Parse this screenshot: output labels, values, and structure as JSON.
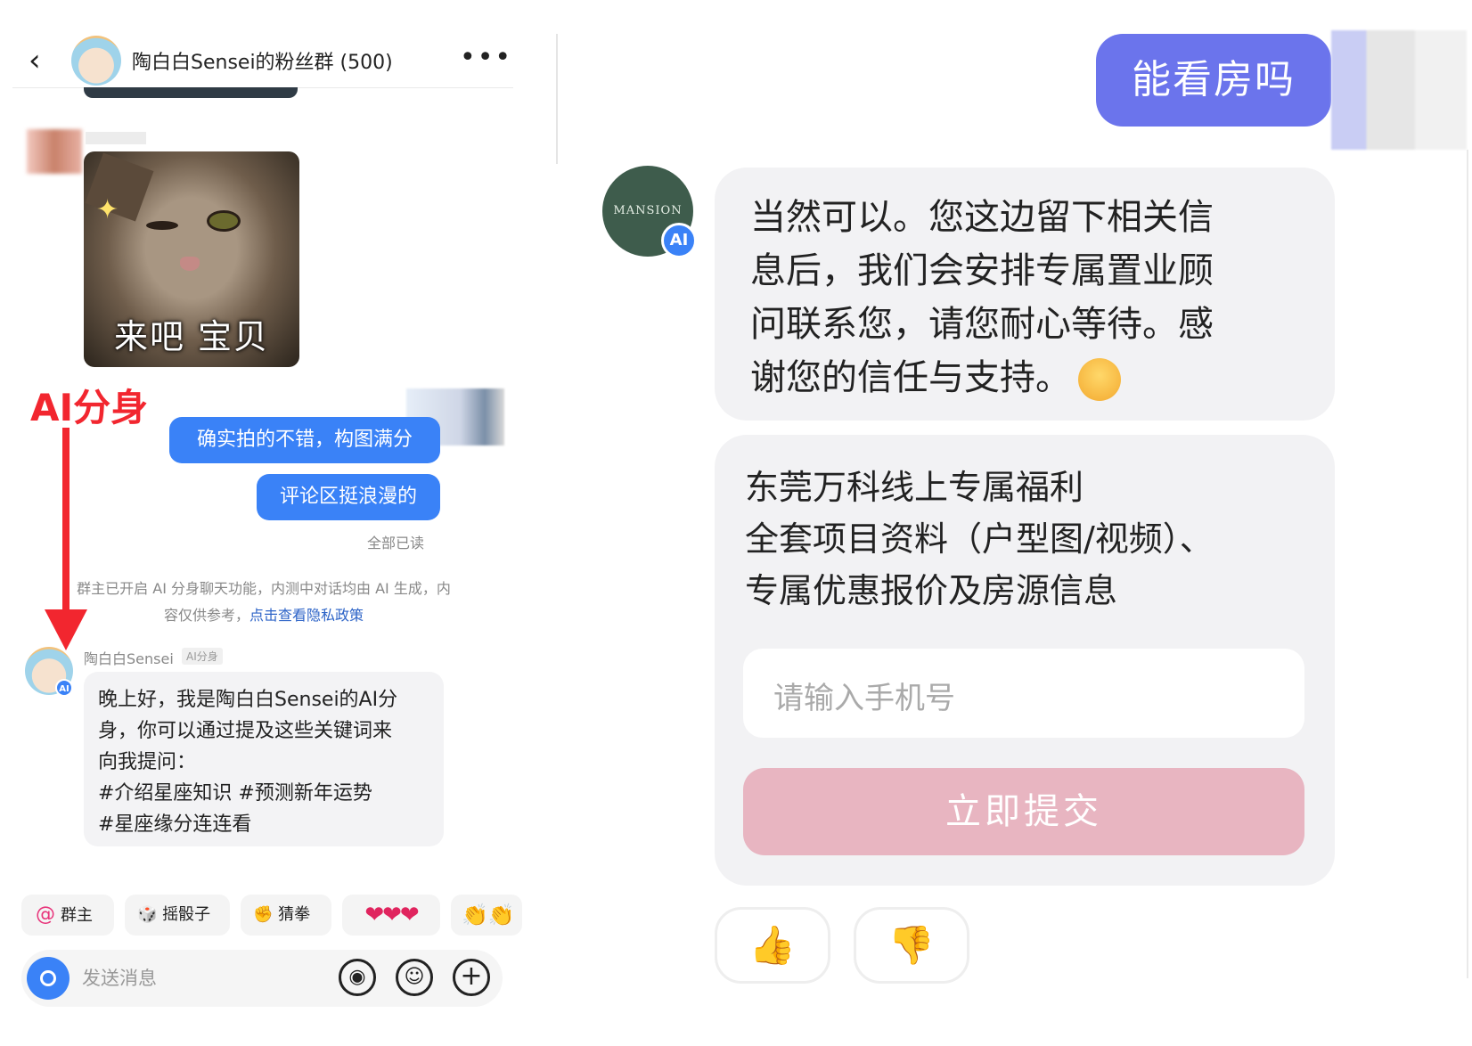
{
  "left": {
    "header": {
      "back": "‹",
      "title": "陶白白Sensei的粉丝群 (500)",
      "more": "•••"
    },
    "sticker": {
      "caption": "来吧 宝贝"
    },
    "annotation": {
      "label": "AI分身"
    },
    "my_messages": [
      "确实拍的不错，构图满分",
      "评论区挺浪漫的"
    ],
    "read_status": "全部已读",
    "system_notice": {
      "text": "群主已开启 AI 分身聊天功能，内测中对话均由 AI 生成，内容仅供参考，",
      "link": "点击查看隐私政策"
    },
    "ai_reply": {
      "sender": "陶白白Sensei",
      "tag": "AI分身",
      "badge": "AI",
      "lines": [
        "晚上好，我是陶白白Sensei的AI分",
        "身，你可以通过提及这些关键词来",
        "向我提问：",
        "#介绍星座知识 #预测新年运势",
        "#星座缘分连连看"
      ]
    },
    "quick_actions": {
      "at_symbol": "@",
      "at_owner": "群主",
      "dice": "摇骰子",
      "guess": "猜拳",
      "hearts": "❤❤❤",
      "clap": "👏👏"
    },
    "input": {
      "placeholder": "发送消息"
    }
  },
  "right": {
    "my_message": "能看房吗",
    "avatar_text": "MANSION",
    "ai_badge": "AI",
    "reply_lines": [
      "当然可以。您这边留下相关信",
      "息后，我们会安排专属置业顾",
      "问联系您，请您耐心等待。感",
      "谢您的信任与支持。"
    ],
    "promo_lines": [
      "东莞万科线上专属福利",
      "全套项目资料（户型图/视频）、",
      "专属优惠报价及房源信息"
    ],
    "phone_placeholder": "请输入手机号",
    "submit_label": "立即提交"
  },
  "colors": {
    "accent_blue": "#3a82f7",
    "annotation_red": "#f2262f",
    "bubble_purple": "#6b74ec",
    "submit_pink": "#e8b5c1"
  }
}
